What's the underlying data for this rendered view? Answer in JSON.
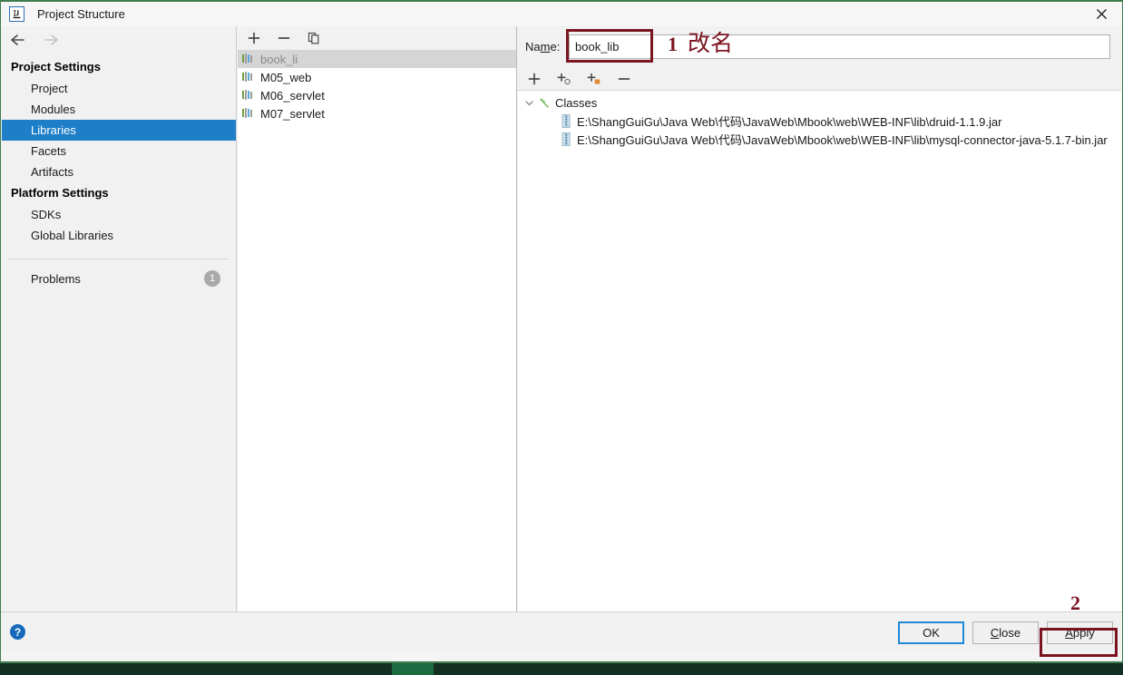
{
  "window": {
    "title": "Project Structure",
    "app_icon": "intellij-idea-icon",
    "close_label": "✕"
  },
  "navigation": {
    "back_icon": "arrow-left-icon",
    "forward_icon": "arrow-right-icon"
  },
  "sidebar": {
    "groups": [
      {
        "title": "Project Settings",
        "items": [
          {
            "label": "Project",
            "selected": false
          },
          {
            "label": "Modules",
            "selected": false
          },
          {
            "label": "Libraries",
            "selected": true
          },
          {
            "label": "Facets",
            "selected": false
          },
          {
            "label": "Artifacts",
            "selected": false
          }
        ]
      },
      {
        "title": "Platform Settings",
        "items": [
          {
            "label": "SDKs",
            "selected": false
          },
          {
            "label": "Global Libraries",
            "selected": false
          }
        ]
      }
    ],
    "problems": {
      "label": "Problems",
      "count": "1"
    }
  },
  "library_list": {
    "toolbar": [
      {
        "name": "add-library-button",
        "glyph": "plus-icon"
      },
      {
        "name": "remove-library-button",
        "glyph": "minus-icon"
      },
      {
        "name": "copy-library-button",
        "glyph": "copy-icon"
      }
    ],
    "items": [
      {
        "label": "book_li",
        "selected": true
      },
      {
        "label": "M05_web",
        "selected": false
      },
      {
        "label": "M06_servlet",
        "selected": false
      },
      {
        "label": "M07_servlet",
        "selected": false
      }
    ]
  },
  "detail": {
    "name_label": "Name:",
    "name_label_mnemonic": "m",
    "name_value": "book_lib",
    "name_placeholder": "",
    "toolbar": [
      {
        "name": "add-jar-button",
        "glyph": "plus-icon"
      },
      {
        "name": "add-class-button",
        "glyph": "plus-circle-icon"
      },
      {
        "name": "add-module-button",
        "glyph": "plus-square-icon"
      },
      {
        "name": "remove-item-button",
        "glyph": "minus-icon"
      }
    ],
    "tree": {
      "root": {
        "label": "Classes",
        "icon": "hammer-icon",
        "expanded": true
      },
      "children": [
        {
          "label": "E:\\ShangGuiGu\\Java Web\\代码\\JavaWeb\\Mbook\\web\\WEB-INF\\lib\\druid-1.1.9.jar",
          "icon": "jar-icon"
        },
        {
          "label": "E:\\ShangGuiGu\\Java Web\\代码\\JavaWeb\\Mbook\\web\\WEB-INF\\lib\\mysql-connector-java-5.1.7-bin.jar",
          "icon": "jar-icon"
        }
      ]
    }
  },
  "footer": {
    "help_label": "?",
    "buttons": [
      {
        "label": "OK",
        "mnemonic": "",
        "name": "ok-button",
        "default": true
      },
      {
        "label": "Close",
        "mnemonic": "C",
        "name": "close-button",
        "default": false
      },
      {
        "label": "Apply",
        "mnemonic": "A",
        "name": "apply-button",
        "default": false
      }
    ]
  },
  "annotations": [
    {
      "id": "annot-1",
      "number": "1",
      "text": "改名"
    },
    {
      "id": "annot-2",
      "number": "2",
      "text": ""
    }
  ],
  "colors": {
    "selection_blue": "#1e7ec8",
    "annotation_red": "#7b1320",
    "default_button_blue": "#1e88d8",
    "window_border_green": "#3f7c4e",
    "taskbar_green": "#143023",
    "badge_gray": "#a9a9a9"
  }
}
